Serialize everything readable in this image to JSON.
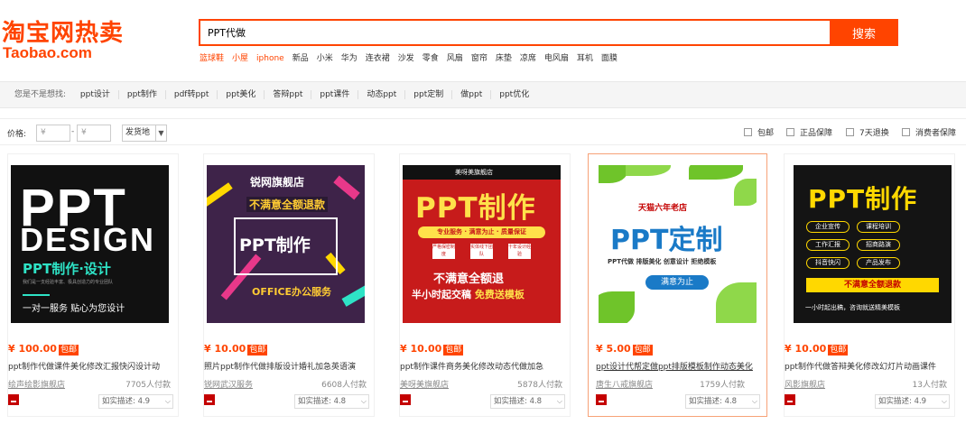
{
  "header": {
    "logo_main": "淘宝网热卖",
    "logo_sub": "Taobao.com",
    "search_value": "PPT代做",
    "search_button": "搜索",
    "hotwords": [
      {
        "text": "篮球鞋",
        "highlight": true
      },
      {
        "text": "小屋",
        "highlight": true
      },
      {
        "text": "iphone",
        "highlight": true
      },
      {
        "text": "新品",
        "highlight": false
      },
      {
        "text": "小米",
        "highlight": false
      },
      {
        "text": "华为",
        "highlight": false
      },
      {
        "text": "连衣裙",
        "highlight": false
      },
      {
        "text": "沙发",
        "highlight": false
      },
      {
        "text": "零食",
        "highlight": false
      },
      {
        "text": "风扇",
        "highlight": false
      },
      {
        "text": "窗帘",
        "highlight": false
      },
      {
        "text": "床垫",
        "highlight": false
      },
      {
        "text": "凉席",
        "highlight": false
      },
      {
        "text": "电风扇",
        "highlight": false
      },
      {
        "text": "耳机",
        "highlight": false
      },
      {
        "text": "面膜",
        "highlight": false
      }
    ]
  },
  "suggest": {
    "prefix": "您是不是想找:",
    "items": [
      "ppt设计",
      "ppt制作",
      "pdf转ppt",
      "ppt美化",
      "答辩ppt",
      "ppt课件",
      "动态ppt",
      "ppt定制",
      "做ppt",
      "ppt优化"
    ]
  },
  "filter": {
    "price_label": "价格:",
    "price_min": "¥",
    "price_max": "¥",
    "dash": "-",
    "ship_from": "发货地",
    "checkboxes": [
      "包邮",
      "正品保障",
      "7天退换",
      "消费者保障"
    ]
  },
  "accent_color": "#ff4400",
  "products": [
    {
      "price": "¥ 100.00",
      "tag": "包邮",
      "title": "ppt制作代做课件美化修改汇报快闪设计动",
      "shop": "绘声绘影旗舰店",
      "paid": "7705人付款",
      "desc": "如实描述: 4.9",
      "image": {
        "l1": "PPT",
        "l2": "DESIGN",
        "l3": "PPT制作·设计",
        "l4": "我们是一支经验丰富、极具创造力的专业团队",
        "l5": "一对一服务  贴心为您设计"
      }
    },
    {
      "price": "¥ 10.00",
      "tag": "包邮",
      "title": "照片ppt制作代做排版设计婚礼加急英语演",
      "shop": "锐网武汉服务",
      "paid": "6608人付款",
      "desc": "如实描述: 4.8",
      "image": {
        "l1": "锐网旗舰店",
        "l2": "不满意全额退款",
        "l3": "PPT制作",
        "l4": "OFFICE办公服务"
      }
    },
    {
      "price": "¥ 10.00",
      "tag": "包邮",
      "title": "ppt制作课件商务美化修改动态代做加急",
      "shop": "美呀美旗舰店",
      "paid": "5878人付款",
      "desc": "如实描述: 4.8",
      "image": {
        "l0": "美呀美旗舰店",
        "l1": "PPT制作",
        "l2": "专业服务 · 满意为止 · 质量保证",
        "b1": "严格保密制度",
        "b2": "实体线下团队",
        "b3": "十年设计经验",
        "l3": "不满意全额退",
        "l4": "半小时起交稿",
        "l5": "免费送模板"
      }
    },
    {
      "price": "¥ 5.00",
      "tag": "包邮",
      "title": "ppt设计代帮定做ppt排版模板制作动态美化",
      "shop": "唐生八戒旗舰店",
      "paid": "1759人付款",
      "desc": "如实描述: 4.8",
      "image": {
        "l0": "天猫六年老店",
        "l1": "PPT定制",
        "l2": "PPT代做  排版美化  创意设计  拒绝模板",
        "l3": "满意为止"
      }
    },
    {
      "price": "¥ 10.00",
      "tag": "包邮",
      "title": "ppt制作代做答辩美化修改幻灯片动画课件",
      "shop": "风影旗舰店",
      "paid": "13人付款",
      "desc": "如实描述: 4.9",
      "image": {
        "l1": "PPT制作",
        "p1": "企业宣传",
        "p2": "课程培训",
        "p3": "工作汇报",
        "p4": "招商路演",
        "p5": "抖音快闪",
        "p6": "产品发布",
        "l2": "不满意全额退款",
        "l3": "一小时起出稿，咨询就送精美模板"
      }
    }
  ]
}
